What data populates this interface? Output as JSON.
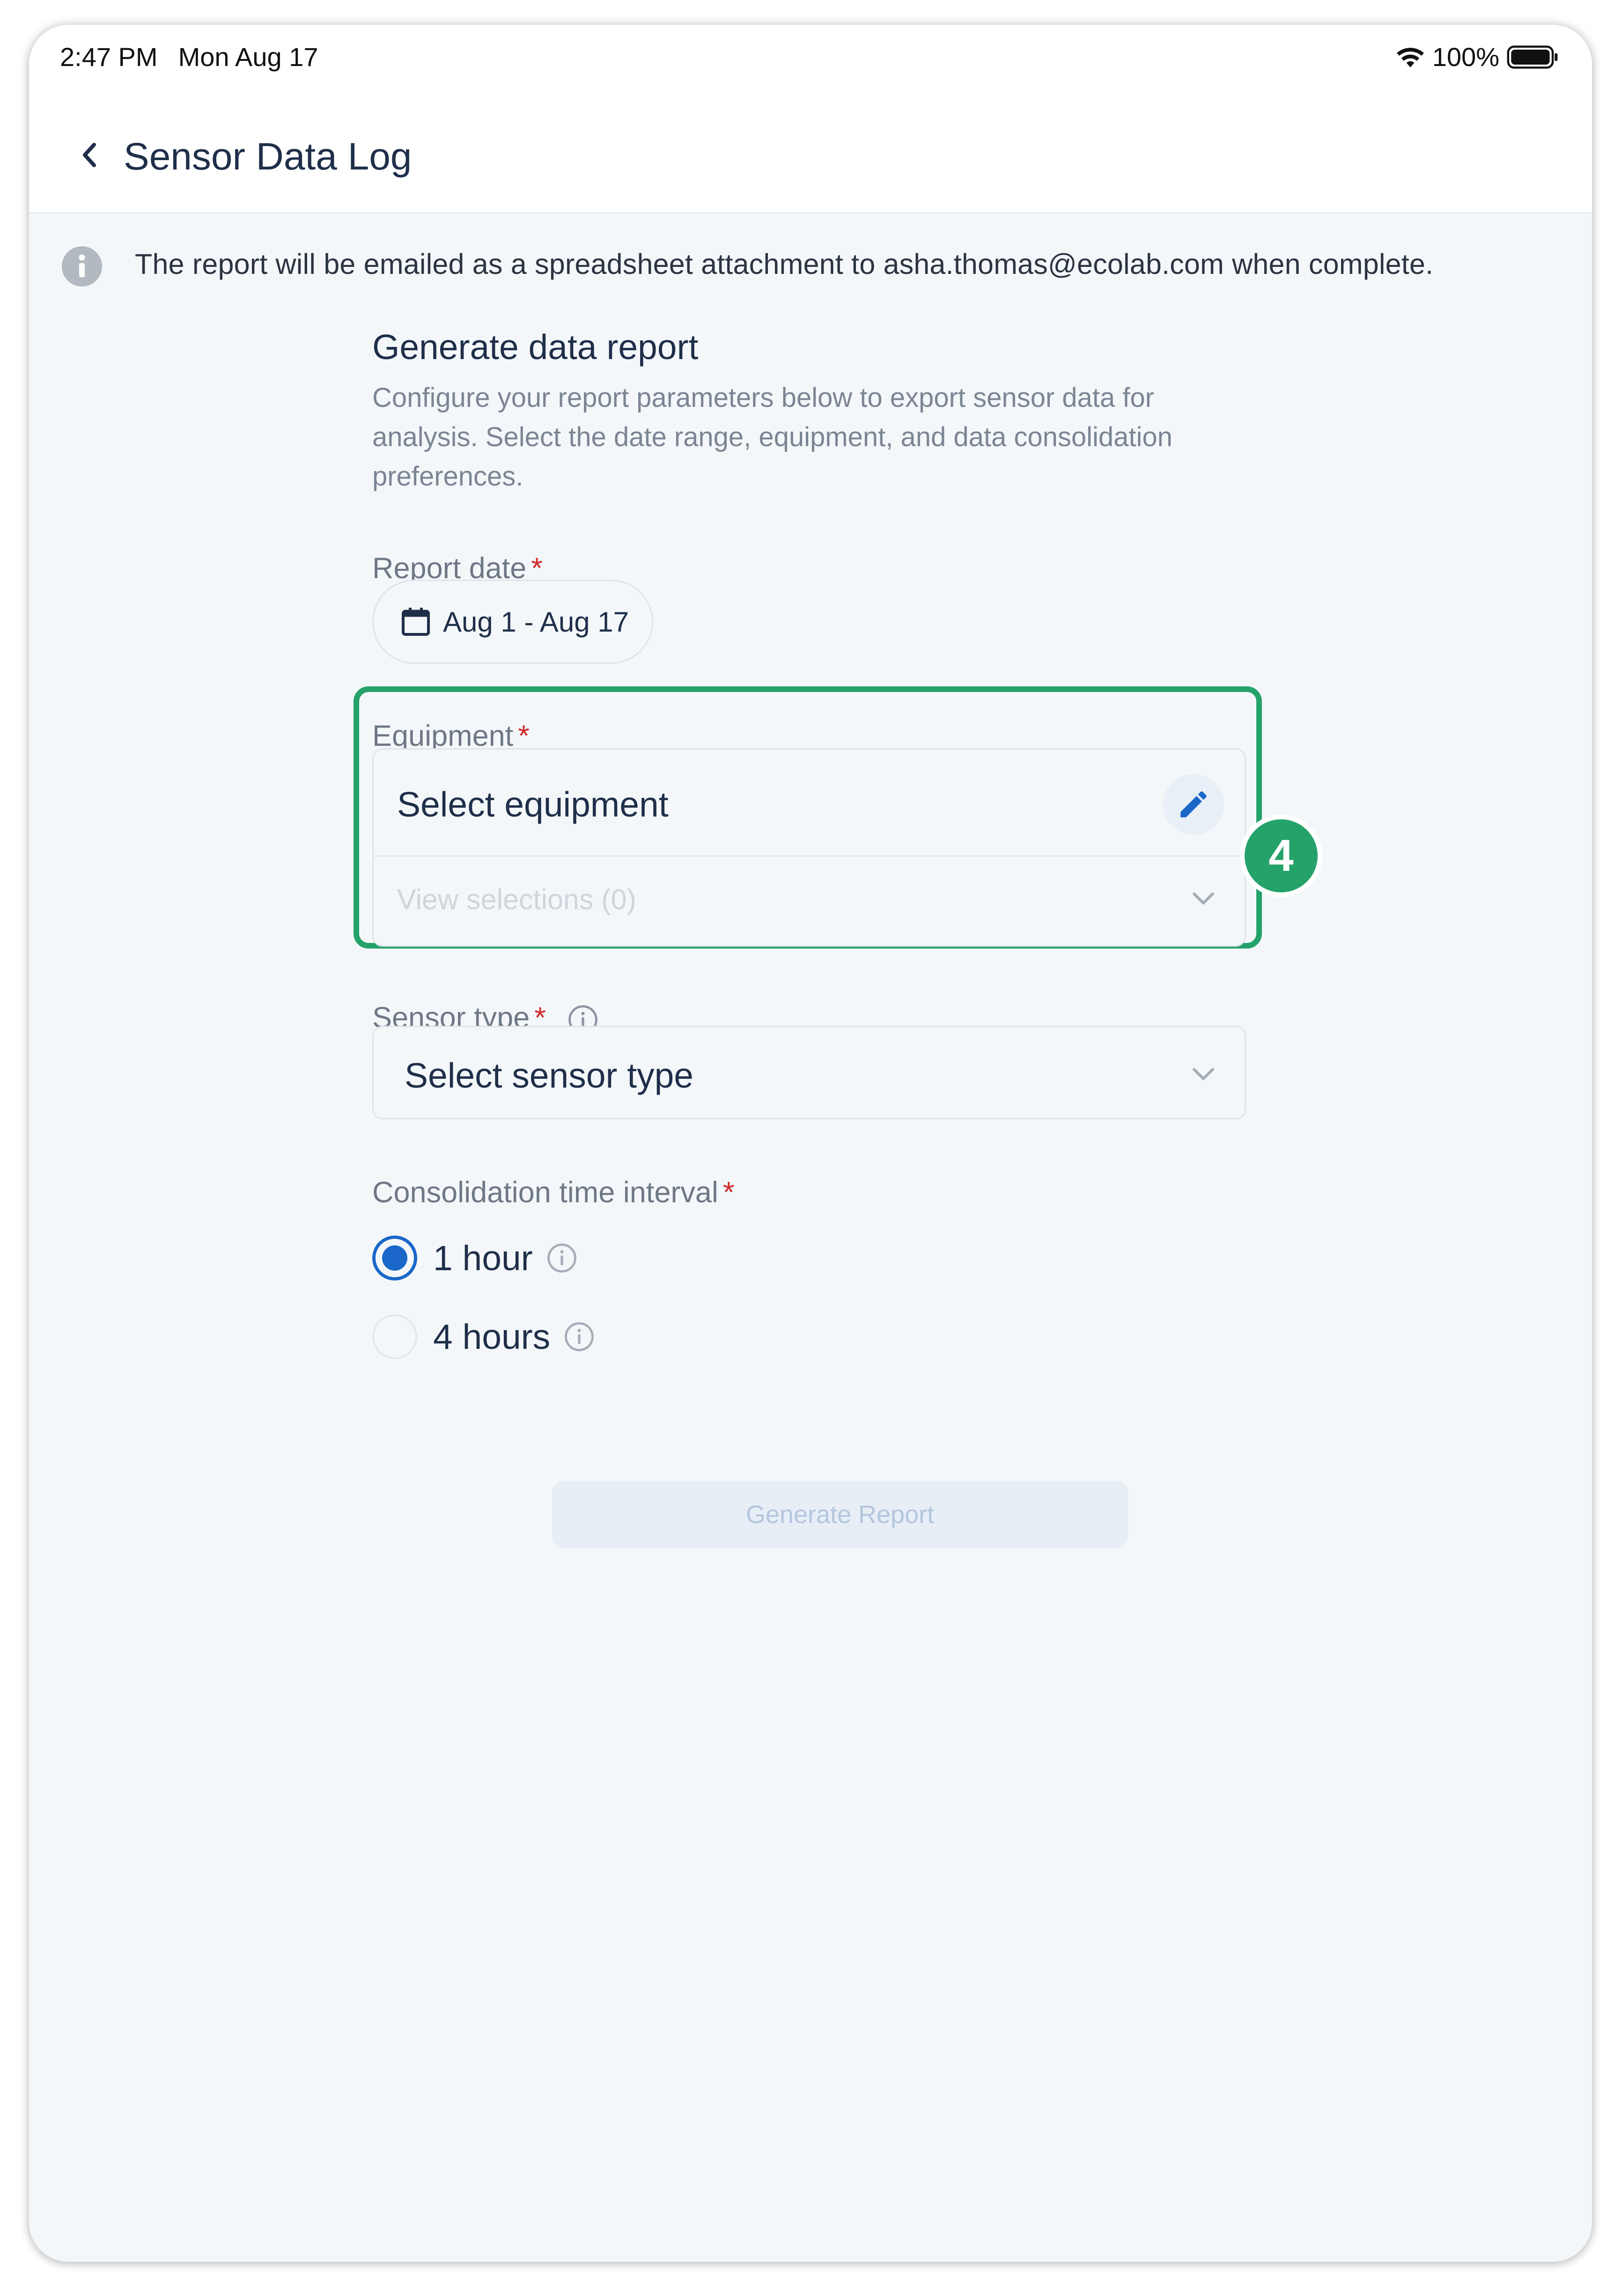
{
  "status_bar": {
    "time": "2:47 PM",
    "date": "Mon Aug 17",
    "battery": "100%"
  },
  "nav": {
    "title": "Sensor Data Log"
  },
  "banner": {
    "text": "The report will be emailed as a spreadsheet attachment to asha.thomas@ecolab.com when complete."
  },
  "form": {
    "title": "Generate data report",
    "description": "Configure your report parameters below to export sensor data for analysis. Select the date range, equipment, and data consolidation preferences.",
    "report_date": {
      "label": "Report date",
      "required_mark": "*",
      "value": "Aug 1 - Aug 17"
    },
    "equipment": {
      "label": "Equipment",
      "required_mark": "*",
      "value": "Select equipment",
      "view_selections": "View selections (0)"
    },
    "sensor_type": {
      "label": "Sensor type",
      "required_mark": "*",
      "value": "Select sensor type"
    },
    "interval": {
      "label": "Consolidation time interval",
      "required_mark": "*",
      "options": [
        {
          "label": "1 hour",
          "selected": true
        },
        {
          "label": "4 hours",
          "selected": false
        }
      ]
    },
    "submit_label": "Generate Report"
  },
  "annotation": {
    "step": "4"
  },
  "colors": {
    "accent": "#1a67c9",
    "highlight": "#24a26a",
    "required": "#d02b2b",
    "title": "#1f2f4a"
  }
}
